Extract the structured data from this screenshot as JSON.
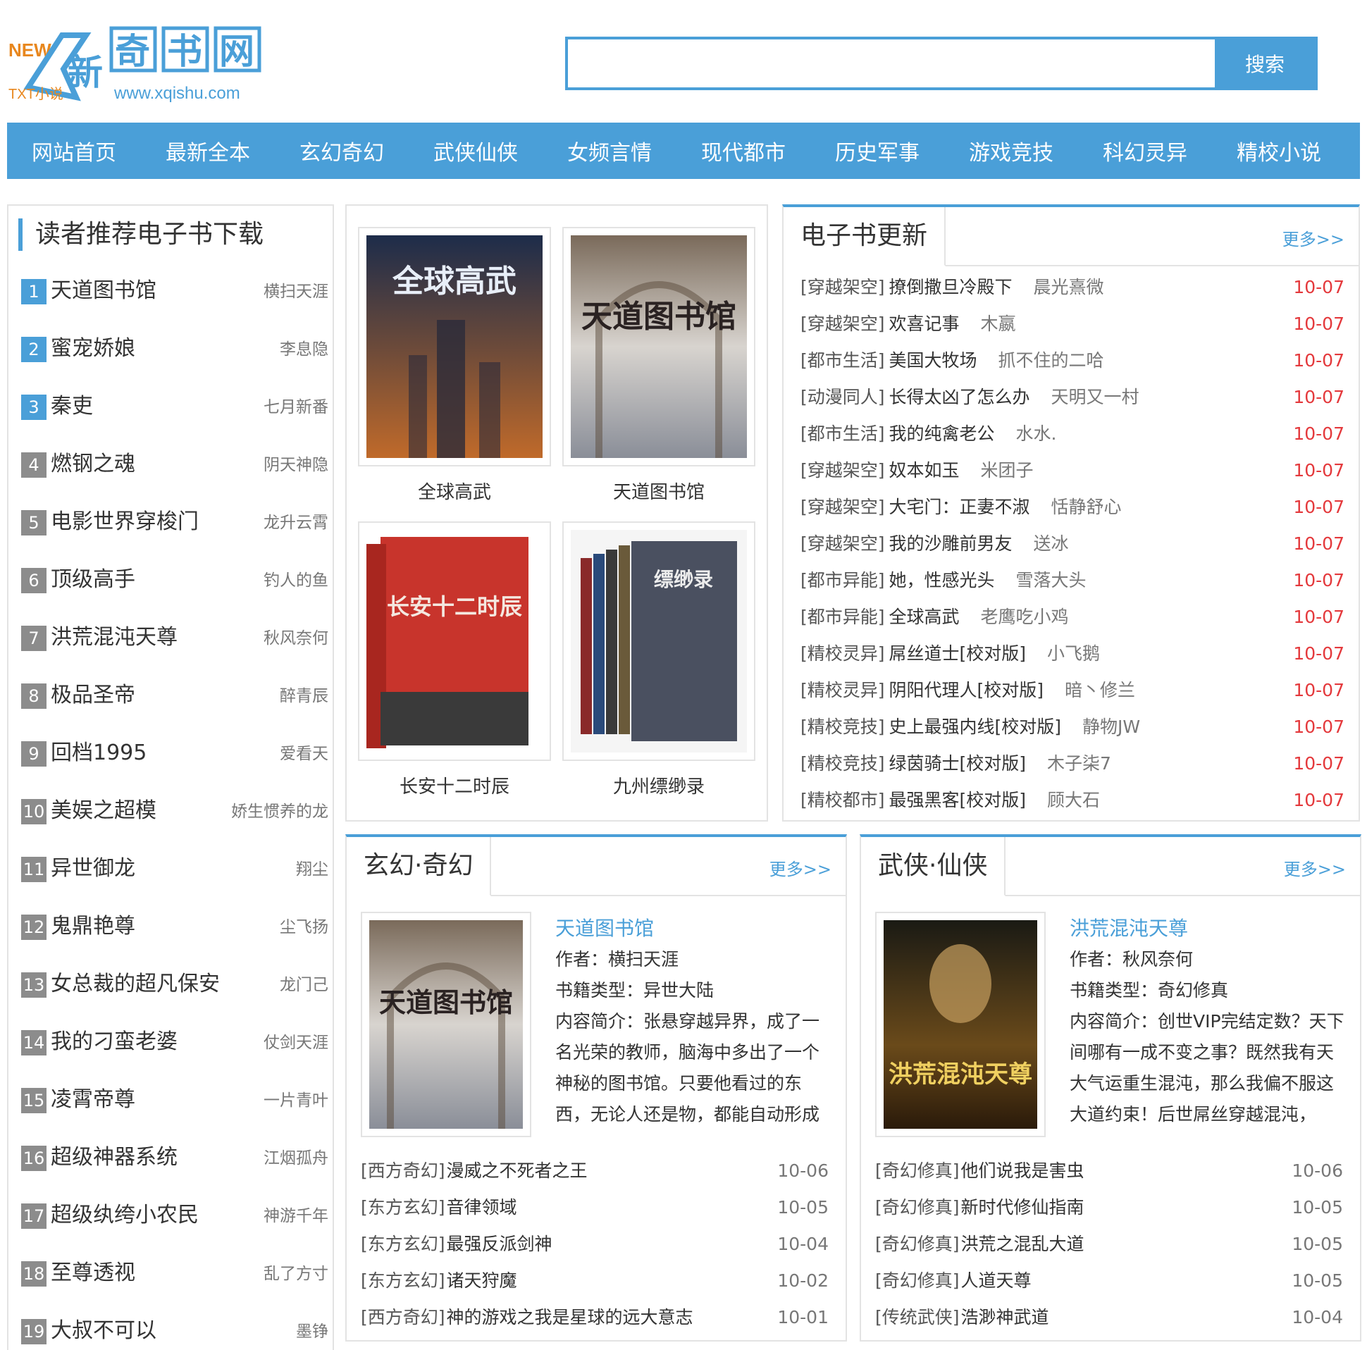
{
  "logo": {
    "badge": "NEW",
    "chars": [
      "新",
      "奇",
      "书",
      "网"
    ],
    "tagline": "TXT小说",
    "domain": "www.xqishu.com"
  },
  "search": {
    "placeholder": "",
    "button_label": "搜索"
  },
  "nav": [
    "网站首页",
    "最新全本",
    "玄幻奇幻",
    "武侠仙侠",
    "女频言情",
    "现代都市",
    "历史军事",
    "游戏竞技",
    "科幻灵异",
    "精校小说"
  ],
  "ranking": {
    "title": "读者推荐电子书下载",
    "items": [
      {
        "num": "1",
        "name": "天道图书馆",
        "author": "横扫天涯"
      },
      {
        "num": "2",
        "name": "蜜宠娇娘",
        "author": "李息隐"
      },
      {
        "num": "3",
        "name": "秦吏",
        "author": "七月新番"
      },
      {
        "num": "4",
        "name": "燃钢之魂",
        "author": "阴天神隐"
      },
      {
        "num": "5",
        "name": "电影世界穿梭门",
        "author": "龙升云霄"
      },
      {
        "num": "6",
        "name": "顶级高手",
        "author": "钓人的鱼"
      },
      {
        "num": "7",
        "name": "洪荒混沌天尊",
        "author": "秋风奈何"
      },
      {
        "num": "8",
        "name": "极品圣帝",
        "author": "醉青辰"
      },
      {
        "num": "9",
        "name": "回档1995",
        "author": "爱看天"
      },
      {
        "num": "10",
        "name": "美娱之超模",
        "author": "娇生惯养的龙"
      },
      {
        "num": "11",
        "name": "异世御龙",
        "author": "翔尘"
      },
      {
        "num": "12",
        "name": "鬼鼎艳尊",
        "author": "尘飞扬"
      },
      {
        "num": "13",
        "name": "女总裁的超凡保安",
        "author": "龙门己"
      },
      {
        "num": "14",
        "name": "我的刁蛮老婆",
        "author": "仗剑天涯"
      },
      {
        "num": "15",
        "name": "凌霄帝尊",
        "author": "一片青叶"
      },
      {
        "num": "16",
        "name": "超级神器系统",
        "author": "江烟孤舟"
      },
      {
        "num": "17",
        "name": "超级纨绔小农民",
        "author": "神游千年"
      },
      {
        "num": "18",
        "name": "至尊透视",
        "author": "乱了方寸"
      },
      {
        "num": "19",
        "name": "大叔不可以",
        "author": "墨铮"
      }
    ]
  },
  "featured": [
    {
      "title": "全球高武",
      "cover_text": "全球高武"
    },
    {
      "title": "天道图书馆",
      "cover_text": "天道图书馆"
    },
    {
      "title": "长安十二时辰",
      "cover_text": "长安十二时辰"
    },
    {
      "title": "九州缥缈录",
      "cover_text": "缥缈录"
    }
  ],
  "updates": {
    "title": "电子书更新",
    "more": "更多>>",
    "items": [
      {
        "cat": "[穿越架空]",
        "name": "撩倒撒旦冷殿下",
        "author": "晨光熹微",
        "date": "10-07"
      },
      {
        "cat": "[穿越架空]",
        "name": "欢喜记事",
        "author": "木嬴",
        "date": "10-07"
      },
      {
        "cat": "[都市生活]",
        "name": "美国大牧场",
        "author": "抓不住的二哈",
        "date": "10-07"
      },
      {
        "cat": "[动漫同人]",
        "name": "长得太凶了怎么办",
        "author": "天明又一村",
        "date": "10-07"
      },
      {
        "cat": "[都市生活]",
        "name": "我的纯禽老公",
        "author": "水水.",
        "date": "10-07"
      },
      {
        "cat": "[穿越架空]",
        "name": "奴本如玉",
        "author": "米团子",
        "date": "10-07"
      },
      {
        "cat": "[穿越架空]",
        "name": "大宅门：正妻不淑",
        "author": "恬静舒心",
        "date": "10-07"
      },
      {
        "cat": "[穿越架空]",
        "name": "我的沙雕前男友",
        "author": "送冰",
        "date": "10-07"
      },
      {
        "cat": "[都市异能]",
        "name": "她，性感光头",
        "author": "雪落大头",
        "date": "10-07"
      },
      {
        "cat": "[都市异能]",
        "name": "全球高武",
        "author": "老鹰吃小鸡",
        "date": "10-07"
      },
      {
        "cat": "[精校灵异]",
        "name": "屌丝道士[校对版]",
        "author": "小飞鹅",
        "date": "10-07"
      },
      {
        "cat": "[精校灵异]",
        "name": "阴阳代理人[校对版]",
        "author": "暗丶修兰",
        "date": "10-07"
      },
      {
        "cat": "[精校竞技]",
        "name": "史上最强内线[校对版]",
        "author": "静物JW",
        "date": "10-07"
      },
      {
        "cat": "[精校竞技]",
        "name": "绿茵骑士[校对版]",
        "author": "木子柒7",
        "date": "10-07"
      },
      {
        "cat": "[精校都市]",
        "name": "最强黑客[校对版]",
        "author": "顾大石",
        "date": "10-07"
      }
    ]
  },
  "xuanhuan": {
    "title": "玄幻·奇幻",
    "more": "更多>>",
    "featured": {
      "title": "天道图书馆",
      "author_label": "作者：",
      "author": "横扫天涯",
      "type_label": "书籍类型：",
      "type": "异世大陆",
      "intro_label": "内容简介：",
      "intro": "张悬穿越异界，成了一名光荣的教师，脑海中多出了一个神秘的图书馆。只要他看过的东西，无论人还是物，都能自动形成"
    },
    "items": [
      {
        "cat": "[西方奇幻]",
        "name": "漫威之不死者之王",
        "date": "10-06"
      },
      {
        "cat": "[东方玄幻]",
        "name": "音律领域",
        "date": "10-05"
      },
      {
        "cat": "[东方玄幻]",
        "name": "最强反派剑神",
        "date": "10-04"
      },
      {
        "cat": "[东方玄幻]",
        "name": "诸天狩魔",
        "date": "10-02"
      },
      {
        "cat": "[西方奇幻]",
        "name": "神的游戏之我是星球的远大意志",
        "date": "10-01"
      }
    ]
  },
  "wuxia": {
    "title": "武侠·仙侠",
    "more": "更多>>",
    "featured": {
      "title": "洪荒混沌天尊",
      "author_label": "作者：",
      "author": "秋风奈何",
      "type_label": "书籍类型：",
      "type": "奇幻修真",
      "intro_label": "内容简介：",
      "intro": "创世VIP完结定数？天下间哪有一成不变之事？既然我有天大气运重生混沌，那么我偏不服这大道约束！后世屌丝穿越混沌，"
    },
    "items": [
      {
        "cat": "[奇幻修真]",
        "name": "他们说我是害虫",
        "date": "10-06"
      },
      {
        "cat": "[奇幻修真]",
        "name": "新时代修仙指南",
        "date": "10-05"
      },
      {
        "cat": "[奇幻修真]",
        "name": "洪荒之混乱大道",
        "date": "10-05"
      },
      {
        "cat": "[奇幻修真]",
        "name": "人道天尊",
        "date": "10-05"
      },
      {
        "cat": "[传统武侠]",
        "name": "浩渺神武道",
        "date": "10-04"
      }
    ]
  },
  "colors": {
    "accent": "#4a9fd8",
    "date_red": "#e4393c",
    "rank_gray": "#8c8c8c"
  }
}
